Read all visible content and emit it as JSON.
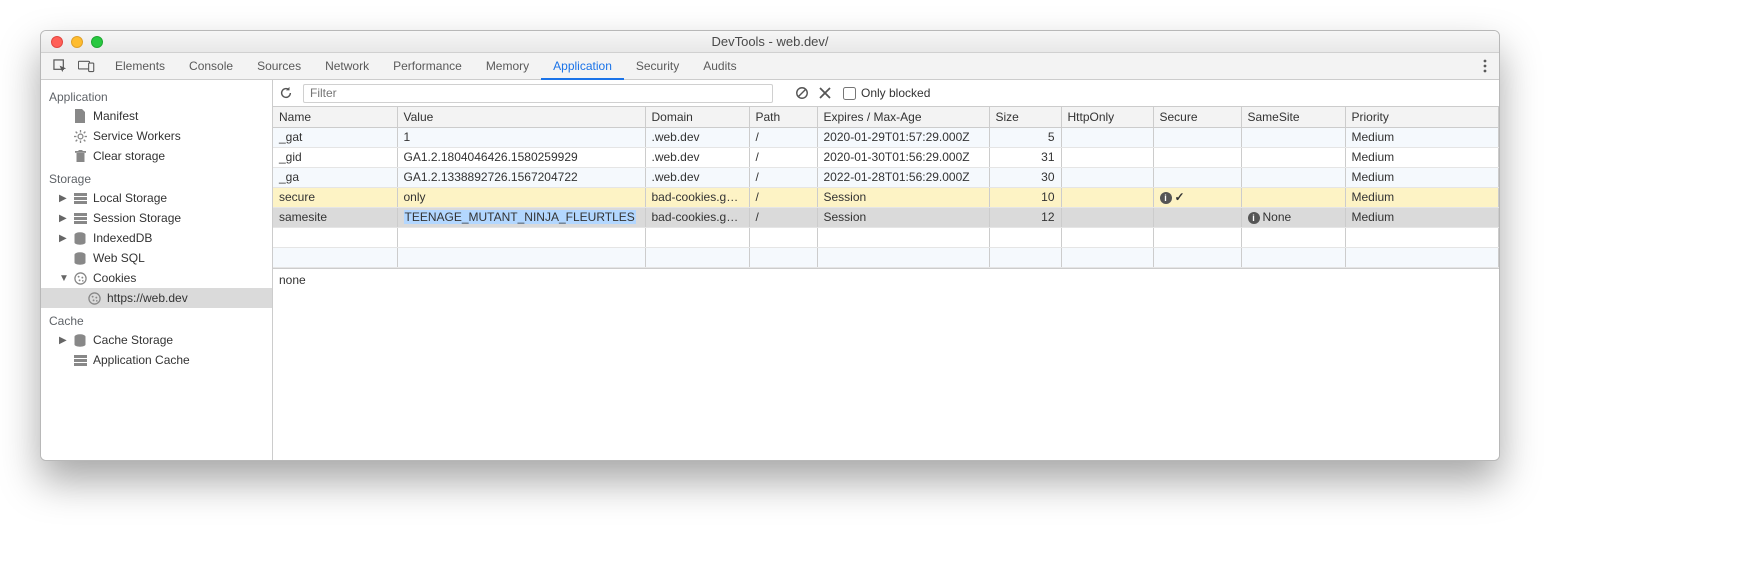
{
  "window": {
    "title": "DevTools - web.dev/"
  },
  "tool_icons": {
    "inspect": "inspect",
    "device": "device",
    "more": "more"
  },
  "tabs": [
    "Elements",
    "Console",
    "Sources",
    "Network",
    "Performance",
    "Memory",
    "Application",
    "Security",
    "Audits"
  ],
  "active_tab": "Application",
  "sidebar": {
    "sections": [
      {
        "title": "Application",
        "items": [
          {
            "icon": "manifest",
            "label": "Manifest"
          },
          {
            "icon": "gear",
            "label": "Service Workers"
          },
          {
            "icon": "trash",
            "label": "Clear storage"
          }
        ]
      },
      {
        "title": "Storage",
        "items": [
          {
            "arrow": "▶",
            "icon": "stack",
            "label": "Local Storage"
          },
          {
            "arrow": "▶",
            "icon": "stack",
            "label": "Session Storage"
          },
          {
            "arrow": "▶",
            "icon": "db",
            "label": "IndexedDB"
          },
          {
            "icon": "db",
            "label": "Web SQL"
          },
          {
            "arrow": "▼",
            "icon": "cookie",
            "label": "Cookies",
            "expanded": true
          },
          {
            "level": 2,
            "icon": "cookie",
            "label": "https://web.dev",
            "selected": true
          }
        ]
      },
      {
        "title": "Cache",
        "items": [
          {
            "arrow": "▶",
            "icon": "db",
            "label": "Cache Storage"
          },
          {
            "icon": "stack",
            "label": "Application Cache"
          }
        ]
      }
    ]
  },
  "toolbar": {
    "filter_placeholder": "Filter",
    "only_blocked_label": "Only blocked"
  },
  "columns": [
    "Name",
    "Value",
    "Domain",
    "Path",
    "Expires / Max-Age",
    "Size",
    "HttpOnly",
    "Secure",
    "SameSite",
    "Priority"
  ],
  "rows": [
    {
      "name": "_gat",
      "value": "1",
      "domain": ".web.dev",
      "path": "/",
      "expires": "2020-01-29T01:57:29.000Z",
      "size": "5",
      "httponly": "",
      "secure": "",
      "samesite": "",
      "priority": "Medium",
      "style": "even"
    },
    {
      "name": "_gid",
      "value": "GA1.2.1804046426.1580259929",
      "domain": ".web.dev",
      "path": "/",
      "expires": "2020-01-30T01:56:29.000Z",
      "size": "31",
      "httponly": "",
      "secure": "",
      "samesite": "",
      "priority": "Medium",
      "style": "odd"
    },
    {
      "name": "_ga",
      "value": "GA1.2.1338892726.1567204722",
      "domain": ".web.dev",
      "path": "/",
      "expires": "2022-01-28T01:56:29.000Z",
      "size": "30",
      "httponly": "",
      "secure": "",
      "samesite": "",
      "priority": "Medium",
      "style": "even"
    },
    {
      "name": "secure",
      "value": "only",
      "domain": "bad-cookies.g…",
      "path": "/",
      "expires": "Session",
      "size": "10",
      "httponly": "",
      "secure_warn": true,
      "secure_check": "✓",
      "samesite": "",
      "priority": "Medium",
      "style": "warn"
    },
    {
      "name": "samesite",
      "value": "TEENAGE_MUTANT_NINJA_FLEURTLES",
      "value_selected": true,
      "domain": "bad-cookies.g…",
      "path": "/",
      "expires": "Session",
      "size": "12",
      "httponly": "",
      "secure": "",
      "samesite_warn": true,
      "samesite": "None",
      "priority": "Medium",
      "style": "sel"
    }
  ],
  "empty_rows": 2,
  "preview": "none"
}
